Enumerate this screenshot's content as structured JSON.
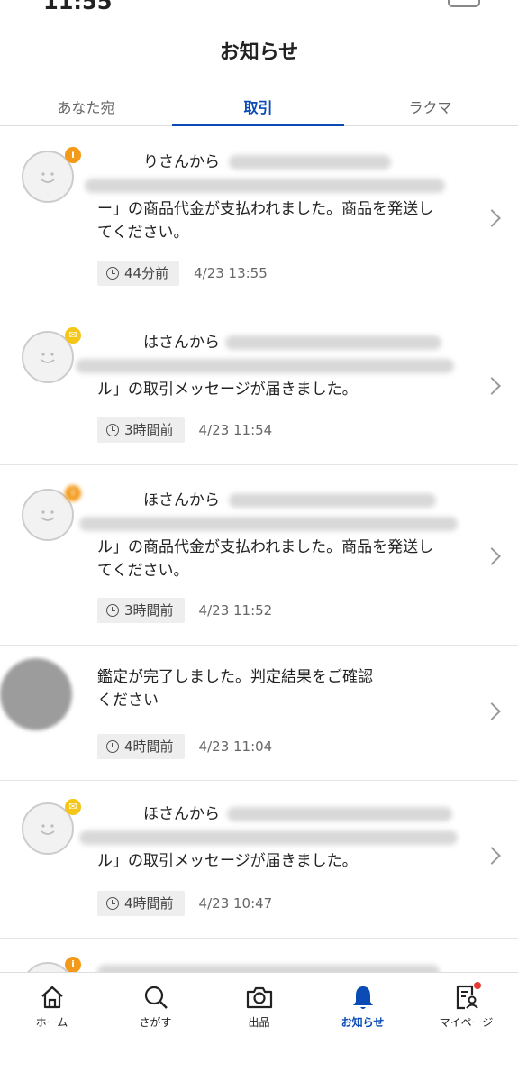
{
  "status_bar": {
    "time": "11:55"
  },
  "header": {
    "title": "お知らせ"
  },
  "tabs": [
    {
      "label": "あなた宛",
      "active": false
    },
    {
      "label": "取引",
      "active": true
    },
    {
      "label": "ラクマ",
      "active": false
    }
  ],
  "notifications": [
    {
      "badge": "info",
      "lines": [
        "　　　りさんから",
        "",
        "ー」の商品代金が支払われました。商品を発送し",
        "てください。"
      ],
      "elapsed": "44分前",
      "date": "4/23 13:55"
    },
    {
      "badge": "mail",
      "lines": [
        "　　　はさんから",
        "",
        "ル」の取引メッセージが届きました。"
      ],
      "elapsed": "3時間前",
      "date": "4/23 11:54"
    },
    {
      "badge": "info",
      "lines": [
        "　　　ほさんから",
        "",
        "ル」の商品代金が支払われました。商品を発送し",
        "てください。"
      ],
      "elapsed": "3時間前",
      "date": "4/23 11:52"
    },
    {
      "badge": "none",
      "lines": [
        "鑑定が完了しました。判定結果をご確認",
        "ください"
      ],
      "elapsed": "4時間前",
      "date": "4/23 11:04"
    },
    {
      "badge": "mail",
      "lines": [
        "　　　ほさんから",
        "",
        "ル」の取引メッセージが届きました。"
      ],
      "elapsed": "4時間前",
      "date": "4/23 10:47"
    }
  ],
  "bottom_nav": [
    {
      "label": "ホーム",
      "icon": "home-icon",
      "active": false
    },
    {
      "label": "さがす",
      "icon": "search-icon",
      "active": false
    },
    {
      "label": "出品",
      "icon": "camera-icon",
      "active": false
    },
    {
      "label": "お知らせ",
      "icon": "bell-icon",
      "active": true
    },
    {
      "label": "マイページ",
      "icon": "mypage-icon",
      "active": false,
      "has_alert": true
    }
  ],
  "colors": {
    "accent": "#0b4bb5",
    "badge_info": "#f39a1a",
    "badge_mail": "#f5c518",
    "alert": "#e53935"
  }
}
